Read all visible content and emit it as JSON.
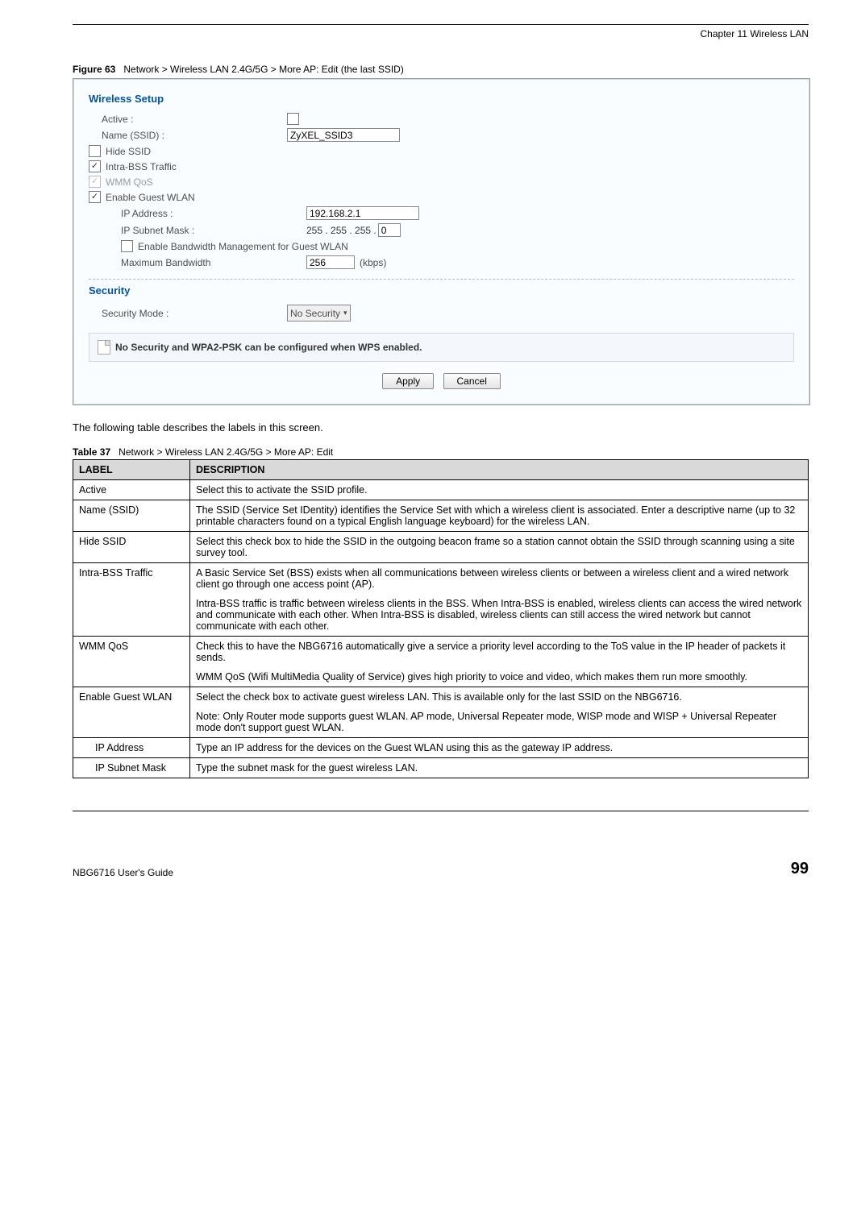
{
  "header": {
    "chapter": "Chapter 11 Wireless LAN"
  },
  "figure": {
    "label": "Figure 63",
    "caption": "Network > Wireless LAN 2.4G/5G > More AP: Edit (the last SSID)"
  },
  "screenshot": {
    "wireless_setup_title": "Wireless Setup",
    "active_label": "Active :",
    "name_label": "Name (SSID) :",
    "name_value": "ZyXEL_SSID3",
    "hide_ssid_label": "Hide SSID",
    "intra_bss_label": "Intra-BSS Traffic",
    "wmm_label": "WMM QoS",
    "enable_guest_label": "Enable Guest WLAN",
    "ip_address_label": "IP Address :",
    "ip_address_value": "192.168.2.1",
    "subnet_label": "IP Subnet Mask :",
    "subnet_prefix": "255 . 255 . 255 .",
    "subnet_last": "0",
    "bwm_label": "Enable Bandwidth Management for Guest WLAN",
    "max_bw_label": "Maximum Bandwidth",
    "max_bw_value": "256",
    "max_bw_unit": "(kbps)",
    "security_title": "Security",
    "security_mode_label": "Security Mode :",
    "security_mode_value": "No Security",
    "note_text": "No Security and WPA2-PSK can be configured when WPS enabled.",
    "apply_label": "Apply",
    "cancel_label": "Cancel"
  },
  "body_text": "The following table describes the labels in this screen.",
  "table": {
    "label": "Table 37",
    "caption": "Network > Wireless LAN 2.4G/5G > More AP: Edit",
    "header_label": "LABEL",
    "header_desc": "DESCRIPTION",
    "rows": [
      {
        "label": "Active",
        "desc": "Select this to activate the SSID profile."
      },
      {
        "label": "Name (SSID)",
        "desc": "The SSID (Service Set IDentity) identifies the Service Set with which a wireless client is associated. Enter a descriptive name (up to 32 printable characters found on a typical English language keyboard) for the wireless LAN."
      },
      {
        "label": "Hide SSID",
        "desc": "Select this check box to hide the SSID in the outgoing beacon frame so a station cannot obtain the SSID through scanning using a site survey tool."
      },
      {
        "label": "Intra-BSS Traffic",
        "desc1": "A Basic Service Set (BSS) exists when all communications between wireless clients or between a wireless client and a wired network client go through one access point (AP).",
        "desc2": "Intra-BSS traffic is traffic between wireless clients in the BSS. When Intra-BSS is enabled, wireless clients can access the wired network and communicate with each other. When Intra-BSS is disabled, wireless clients can still access the wired network but cannot communicate with each other."
      },
      {
        "label": "WMM QoS",
        "desc1": "Check this to have the NBG6716 automatically give a service a priority level according to the ToS value in the IP header of packets it sends.",
        "desc2": "WMM QoS (Wifi MultiMedia Quality of Service) gives high priority to voice and video, which makes them run more smoothly."
      },
      {
        "label": "Enable Guest WLAN",
        "desc1": "Select the check box to activate guest wireless LAN. This is available only for the last SSID on the NBG6716.",
        "desc2": "Note: Only Router mode supports guest WLAN. AP mode, Universal Repeater mode, WISP mode and WISP + Universal Repeater mode don't support guest WLAN."
      },
      {
        "label": "IP Address",
        "sub": true,
        "desc": "Type an IP address for the devices on the Guest WLAN using this as the gateway IP address."
      },
      {
        "label": "IP Subnet Mask",
        "sub": true,
        "desc": "Type the subnet mask for the guest wireless LAN."
      }
    ]
  },
  "footer": {
    "guide": "NBG6716 User's Guide",
    "page": "99"
  }
}
